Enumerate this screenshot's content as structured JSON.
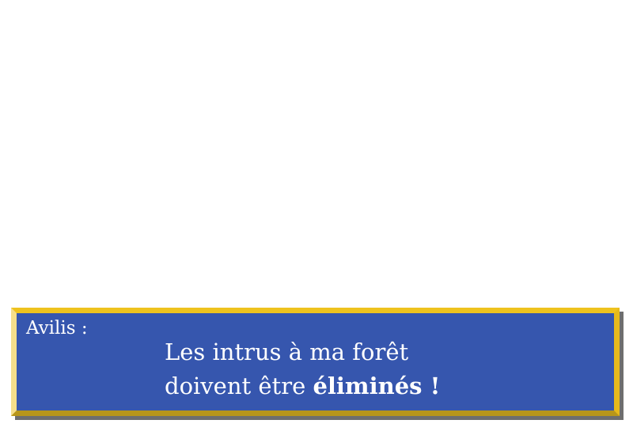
{
  "dialogue": {
    "speaker": "Avilis :",
    "line1": "Les intrus à ma forêt",
    "line2_prefix": "doivent être ",
    "line2_emphasis": "éliminés !"
  },
  "colors": {
    "box_fill": "#3656ae",
    "border": "#eec21e",
    "text": "#ffffff"
  }
}
